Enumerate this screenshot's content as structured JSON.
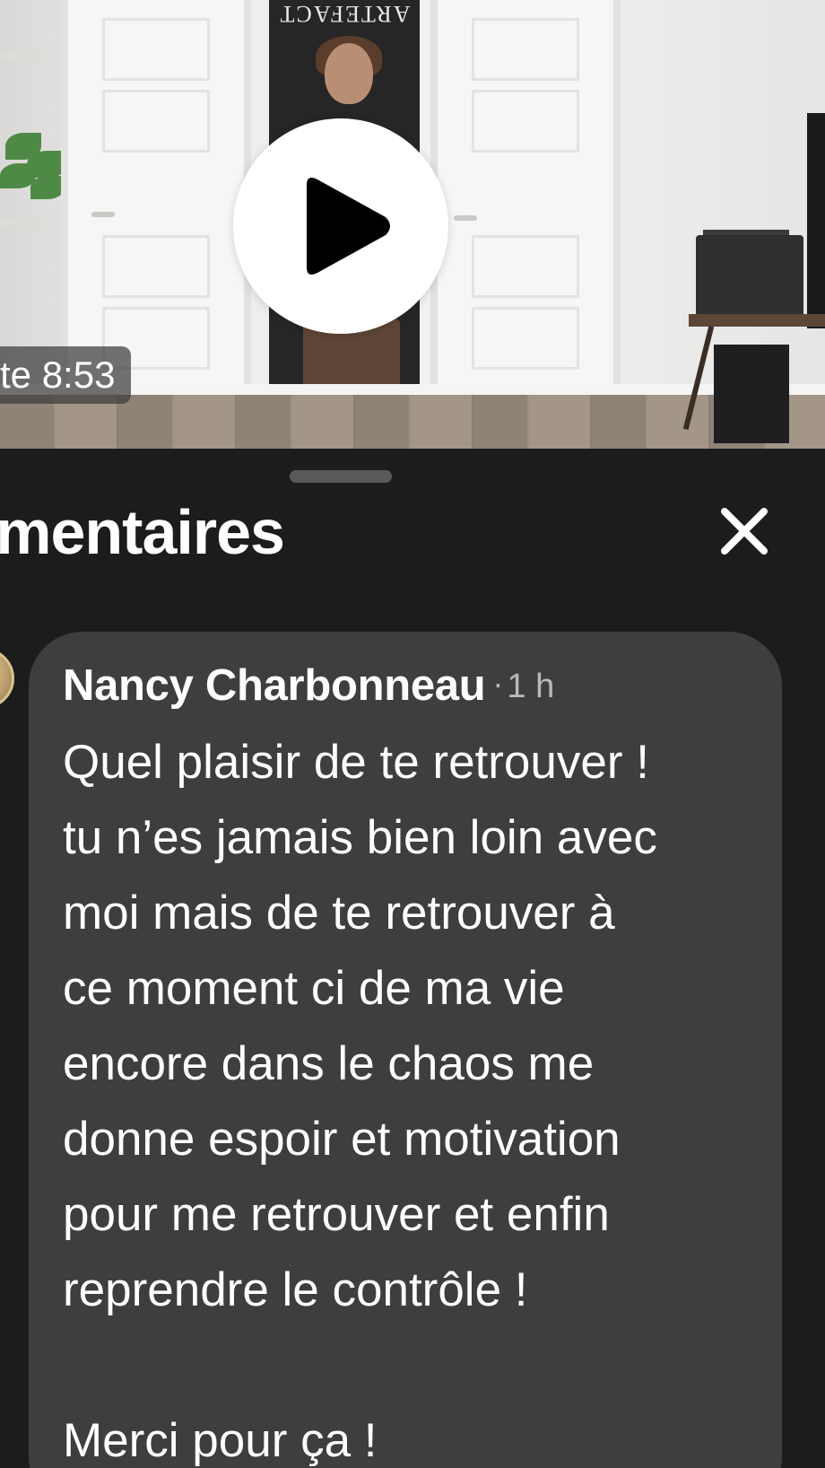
{
  "video": {
    "time_label": "te 8:53",
    "banner_text": "ARTEFACT"
  },
  "sheet": {
    "title": "mmentaires"
  },
  "comment": {
    "author": "Nancy Charbonneau",
    "separator": "·",
    "time": "1 h",
    "lines": [
      "Quel plaisir de te retrouver !",
      "tu n’es jamais bien loin avec",
      "moi mais de te retrouver à",
      "ce moment ci de ma vie",
      "encore dans le chaos me",
      "donne espoir et motivation",
      "pour me retrouver et enfin",
      "reprendre le contrôle !",
      "",
      "Merci pour ça !"
    ]
  },
  "colors": {
    "sheet_bg": "#1c1c1c",
    "bubble_bg": "#3e3e3f",
    "text": "#ffffff",
    "muted": "#b9b9b9"
  },
  "icons": {
    "play": "play-icon",
    "close": "close-icon"
  }
}
